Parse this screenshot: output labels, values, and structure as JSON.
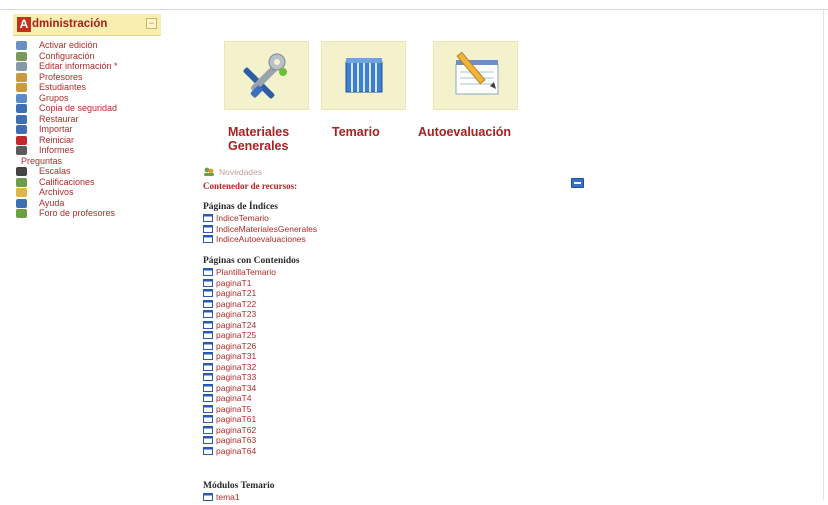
{
  "admin": {
    "letter": "A",
    "title": "dministración",
    "collapse": "−",
    "items": [
      {
        "label": "Activar edición",
        "icon": "edit-icon",
        "color": "#6a8fc0"
      },
      {
        "label": "Configuración",
        "icon": "settings-icon",
        "color": "#7a9a5a"
      },
      {
        "label": "Editar información *",
        "icon": "info-icon",
        "color": "#8899aa"
      },
      {
        "label": "Profesores",
        "icon": "teachers-icon",
        "color": "#c99a40"
      },
      {
        "label": "Estudiantes",
        "icon": "students-icon",
        "color": "#c99a40"
      },
      {
        "label": "Grupos",
        "icon": "groups-icon",
        "color": "#5a8acc"
      },
      {
        "label": "Copia de seguridad",
        "icon": "backup-icon",
        "color": "#3d6fb5"
      },
      {
        "label": "Restaurar",
        "icon": "restore-icon",
        "color": "#3d6fb5"
      },
      {
        "label": "Importar",
        "icon": "import-icon",
        "color": "#3d6fb5"
      },
      {
        "label": "Reiniciar",
        "icon": "reset-icon",
        "color": "#c0282a"
      },
      {
        "label": "Informes",
        "icon": "reports-icon",
        "color": "#5a5a5a"
      },
      {
        "label": "Preguntas",
        "icon": "",
        "color": ""
      },
      {
        "label": "Escalas",
        "icon": "scales-icon",
        "color": "#444"
      },
      {
        "label": "Calificaciones",
        "icon": "grades-icon",
        "color": "#6c9c4c"
      },
      {
        "label": "Archivos",
        "icon": "folder-icon",
        "color": "#e0b840"
      },
      {
        "label": "Ayuda",
        "icon": "help-icon",
        "color": "#3d6fb5"
      },
      {
        "label": "Foro de profesores",
        "icon": "forum-icon",
        "color": "#6aa040"
      }
    ]
  },
  "tiles": {
    "materiales": "Materiales\nGenerales",
    "materiales_1": "Materiales",
    "materiales_2": "Generales",
    "temario": "Temario",
    "autoevaluacion": "Autoevaluación"
  },
  "news": {
    "label": "Novedades"
  },
  "resources": {
    "label": "Contenedor de recursos:"
  },
  "sections": [
    {
      "title": "Páginas de Índices",
      "items": [
        "IndiceTemario",
        "IndiceMaterialesGenerales",
        "IndiceAutoevaluaciones"
      ]
    },
    {
      "title": "Páginas con Contenidos",
      "items": [
        "PlantillaTemario",
        "paginaT1",
        "paginaT21",
        "paginaT22",
        "paginaT23",
        "paginaT24",
        "paginaT25",
        "paginaT26",
        "paginaT31",
        "paginaT32",
        "paginaT33",
        "paginaT34",
        "paginaT4",
        "paginaT5",
        "paginaT61",
        "paginaT62",
        "paginaT63",
        "paginaT64"
      ]
    },
    {
      "title": "Módulos Temario",
      "items": [
        "tema1"
      ]
    }
  ],
  "colors": {
    "link": "#b32a2a",
    "header_bg": "#f8eeb0",
    "tile_bg": "#f4f2cc"
  }
}
